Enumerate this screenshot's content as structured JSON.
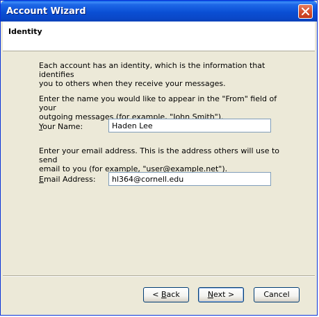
{
  "window": {
    "title": "Account Wizard"
  },
  "header": {
    "title": "Identity"
  },
  "content": {
    "intro": "Each account has an identity, which is the information that identifies\nyou to others when they receive your messages.",
    "name_prompt": "Enter the name you would like to appear in the \"From\" field of your\noutgoing messages (for example, \"John Smith\").",
    "name_label_accel": "Y",
    "name_label_rest": "our Name:",
    "name_value": "Haden Lee",
    "email_prompt": "Enter your email address. This is the address others will use to send\nemail to you (for example, \"user@example.net\").",
    "email_label_accel": "E",
    "email_label_rest": "mail Address:",
    "email_value": "hl364@cornell.edu"
  },
  "buttons": {
    "back_prefix": "< ",
    "back_accel": "B",
    "back_rest": "ack",
    "next_accel": "N",
    "next_rest": "ext >",
    "cancel": "Cancel"
  },
  "colors": {
    "titlebar": "#0a4fd4",
    "dialog_bg": "#ece9d8",
    "close_button": "#d5502f"
  }
}
